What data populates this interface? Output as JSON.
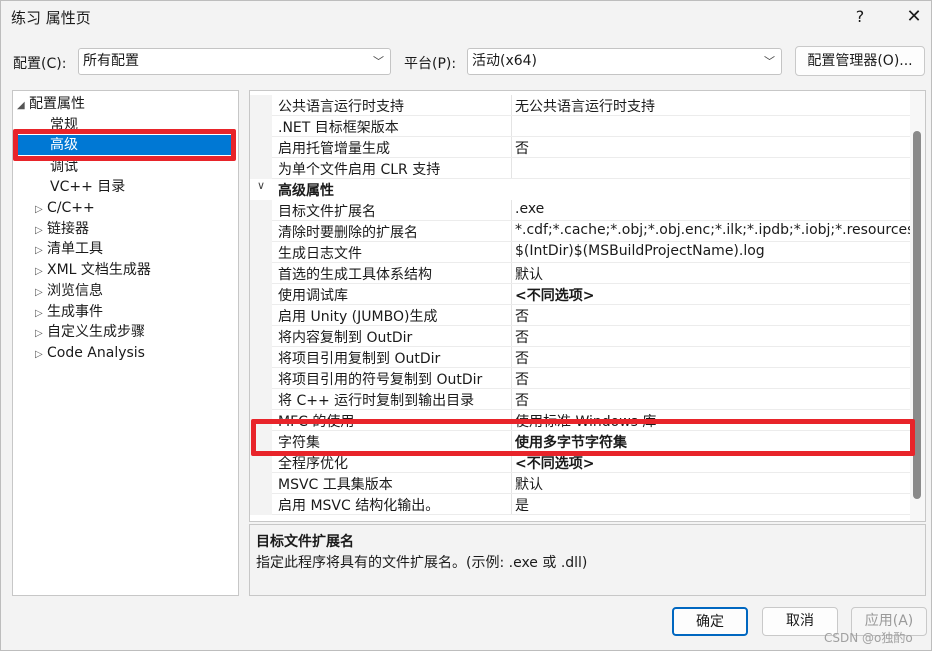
{
  "window": {
    "title": "练习 属性页",
    "help": "?",
    "close": "✕"
  },
  "config": {
    "config_label": "配置(C):",
    "config_value": "所有配置",
    "platform_label": "平台(P):",
    "platform_value": "活动(x64)",
    "manager_button": "配置管理器(O)..."
  },
  "tree": {
    "root": "配置属性",
    "items": [
      "常规",
      "高级",
      "调试",
      "VC++ 目录"
    ],
    "expandables": [
      "C/C++",
      "链接器",
      "清单工具",
      "XML 文档生成器",
      "浏览信息",
      "生成事件",
      "自定义生成步骤",
      "Code Analysis"
    ],
    "selected": "高级"
  },
  "grid": {
    "rows": [
      {
        "name": "公共语言运行时支持",
        "value": "无公共语言运行时支持"
      },
      {
        "name": ".NET 目标框架版本",
        "value": ""
      },
      {
        "name": "启用托管增量生成",
        "value": "否"
      },
      {
        "name": "为单个文件启用 CLR 支持",
        "value": ""
      }
    ],
    "category": "高级属性",
    "adv_rows": [
      {
        "name": "目标文件扩展名",
        "value": ".exe"
      },
      {
        "name": "清除时要删除的扩展名",
        "value": "*.cdf;*.cache;*.obj;*.obj.enc;*.ilk;*.ipdb;*.iobj;*.resources;*.tl"
      },
      {
        "name": "生成日志文件",
        "value": "$(IntDir)$(MSBuildProjectName).log"
      },
      {
        "name": "首选的生成工具体系结构",
        "value": "默认"
      },
      {
        "name": "使用调试库",
        "value": "<不同选项>"
      },
      {
        "name": "启用 Unity (JUMBO)生成",
        "value": "否"
      },
      {
        "name": "将内容复制到 OutDir",
        "value": "否"
      },
      {
        "name": "将项目引用复制到 OutDir",
        "value": "否"
      },
      {
        "name": "将项目引用的符号复制到 OutDir",
        "value": "否"
      },
      {
        "name": "将 C++ 运行时复制到输出目录",
        "value": "否"
      },
      {
        "name": "MFC 的使用",
        "value": "使用标准 Windows 库"
      },
      {
        "name": "字符集",
        "value": "使用多字节字符集"
      },
      {
        "name": "全程序优化",
        "value": "<不同选项>"
      },
      {
        "name": "MSVC 工具集版本",
        "value": "默认"
      },
      {
        "name": "启用 MSVC 结构化输出。",
        "value": "是"
      }
    ]
  },
  "description": {
    "title": "目标文件扩展名",
    "text": "指定此程序将具有的文件扩展名。(示例: .exe 或 .dll)"
  },
  "buttons": {
    "ok": "确定",
    "cancel": "取消",
    "apply": "应用(A)"
  },
  "watermark": "CSDN @o独酌o"
}
